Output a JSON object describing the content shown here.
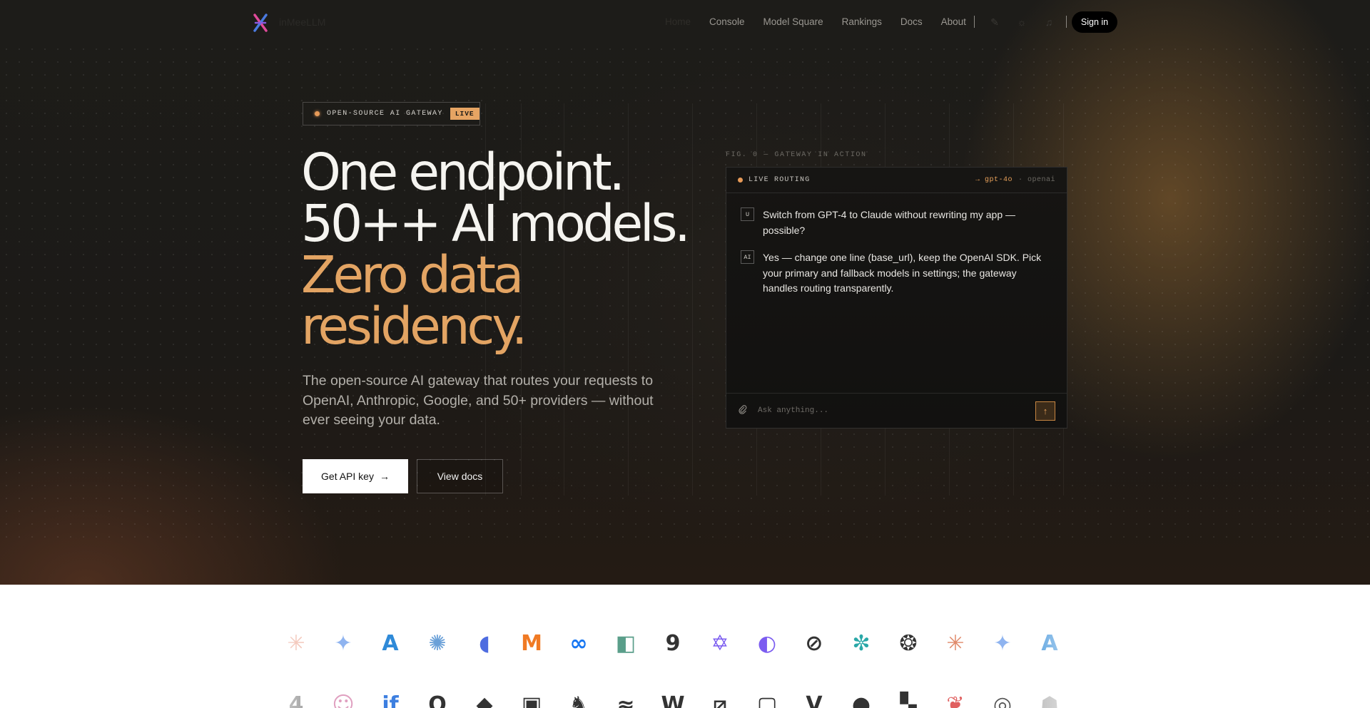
{
  "nav": {
    "brand": "inMeeLLM",
    "links": [
      "Home",
      "Console",
      "Model Square",
      "Rankings",
      "Docs",
      "About"
    ],
    "signin_label": "Sign in",
    "icons": [
      "translate-icon",
      "theme-icon",
      "bell-icon"
    ]
  },
  "hero": {
    "badge_text": "OPEN-SOURCE AI GATEWAY",
    "badge_live": "LIVE",
    "headline_line1": "One endpoint.",
    "headline_line2": "50++ AI models.",
    "headline_line3": "Zero data",
    "headline_line4": "residency.",
    "subtext": "The open-source AI gateway that routes your requests to OpenAI, Anthropic, Google, and 50+ providers — without ever seeing your data.",
    "primary_button": "Get API key",
    "primary_arrow": "→",
    "secondary_button": "View docs"
  },
  "demo": {
    "caption": "FIG. 0 — GATEWAY IN ACTION",
    "live_label": "LIVE ROUTING",
    "route_model": "→ gpt-4o",
    "route_provider": "· openai",
    "messages": [
      {
        "tag": "U",
        "text": "Switch from GPT-4 to Claude without rewriting my app — possible?"
      },
      {
        "tag": "AI",
        "text": "Yes — change one line (base_url), keep the OpenAI SDK. Pick your primary and fallback models in settings; the gateway handles routing transparently."
      }
    ],
    "input_placeholder": "Ask anything...",
    "send_icon": "↑",
    "attach_icon": "⌕"
  },
  "logos": {
    "row1": [
      {
        "name": "anthropic-icon",
        "glyph": "✳",
        "color": "#f0b8a8"
      },
      {
        "name": "gemini-icon",
        "glyph": "✦",
        "color": "#8fb4f0"
      },
      {
        "name": "azure-icon",
        "glyph": "A",
        "color": "#2f8ad8"
      },
      {
        "name": "brain-icon",
        "glyph": "✺",
        "color": "#6aa0d8"
      },
      {
        "name": "deepseek-icon",
        "glyph": "◖",
        "color": "#4e6ce0"
      },
      {
        "name": "mistral-icon",
        "glyph": "M",
        "color": "#f07a24"
      },
      {
        "name": "meta-icon",
        "glyph": "∞",
        "color": "#1877f2"
      },
      {
        "name": "figma-like-icon",
        "glyph": "◧",
        "color": "#5a9e8a"
      },
      {
        "name": "nine-icon",
        "glyph": "9",
        "color": "#333333"
      },
      {
        "name": "zhipu-icon",
        "glyph": "✡",
        "color": "#7b5cf0"
      },
      {
        "name": "kimi-icon",
        "glyph": "◐",
        "color": "#7b5cf0"
      },
      {
        "name": "grok-icon",
        "glyph": "⊘",
        "color": "#333333"
      },
      {
        "name": "perplexity-icon",
        "glyph": "✼",
        "color": "#2aa8a8"
      },
      {
        "name": "openai-icon",
        "glyph": "❂",
        "color": "#333333"
      },
      {
        "name": "claude-icon",
        "glyph": "✳",
        "color": "#e08a6a"
      },
      {
        "name": "gemini-icon-2",
        "glyph": "✦",
        "color": "#8fb4f0"
      },
      {
        "name": "azure-icon-2",
        "glyph": "A",
        "color": "#2f8ad8"
      }
    ],
    "row2": [
      {
        "name": "four-icon",
        "glyph": "4",
        "color": "#999999"
      },
      {
        "name": "avatar-icon",
        "glyph": "☺",
        "color": "#e0a0c0"
      },
      {
        "name": "iflytek-icon",
        "glyph": "if",
        "color": "#3d7fe0"
      },
      {
        "name": "q-icon",
        "glyph": "Q",
        "color": "#333333"
      },
      {
        "name": "cube-icon",
        "glyph": "◆",
        "color": "#333333"
      },
      {
        "name": "robot-icon",
        "glyph": "▣",
        "color": "#333333"
      },
      {
        "name": "ollama-icon",
        "glyph": "♞",
        "color": "#333333"
      },
      {
        "name": "kangaroo-icon",
        "glyph": "≈",
        "color": "#333333"
      },
      {
        "name": "wave-icon",
        "glyph": "W",
        "color": "#333333"
      },
      {
        "name": "slash-icon",
        "glyph": "⧄",
        "color": "#333333"
      },
      {
        "name": "frame-icon",
        "glyph": "▢",
        "color": "#333333"
      },
      {
        "name": "v-icon",
        "glyph": "V",
        "color": "#333333"
      },
      {
        "name": "blob-icon",
        "glyph": "●",
        "color": "#333333"
      },
      {
        "name": "blocks-icon",
        "glyph": "▚",
        "color": "#333333"
      },
      {
        "name": "apple-icon",
        "glyph": "❦",
        "color": "#e06060"
      },
      {
        "name": "spiral-icon",
        "glyph": "◎",
        "color": "#555555"
      },
      {
        "name": "ghost-icon",
        "glyph": "☗",
        "color": "#aaaaaa"
      }
    ]
  }
}
